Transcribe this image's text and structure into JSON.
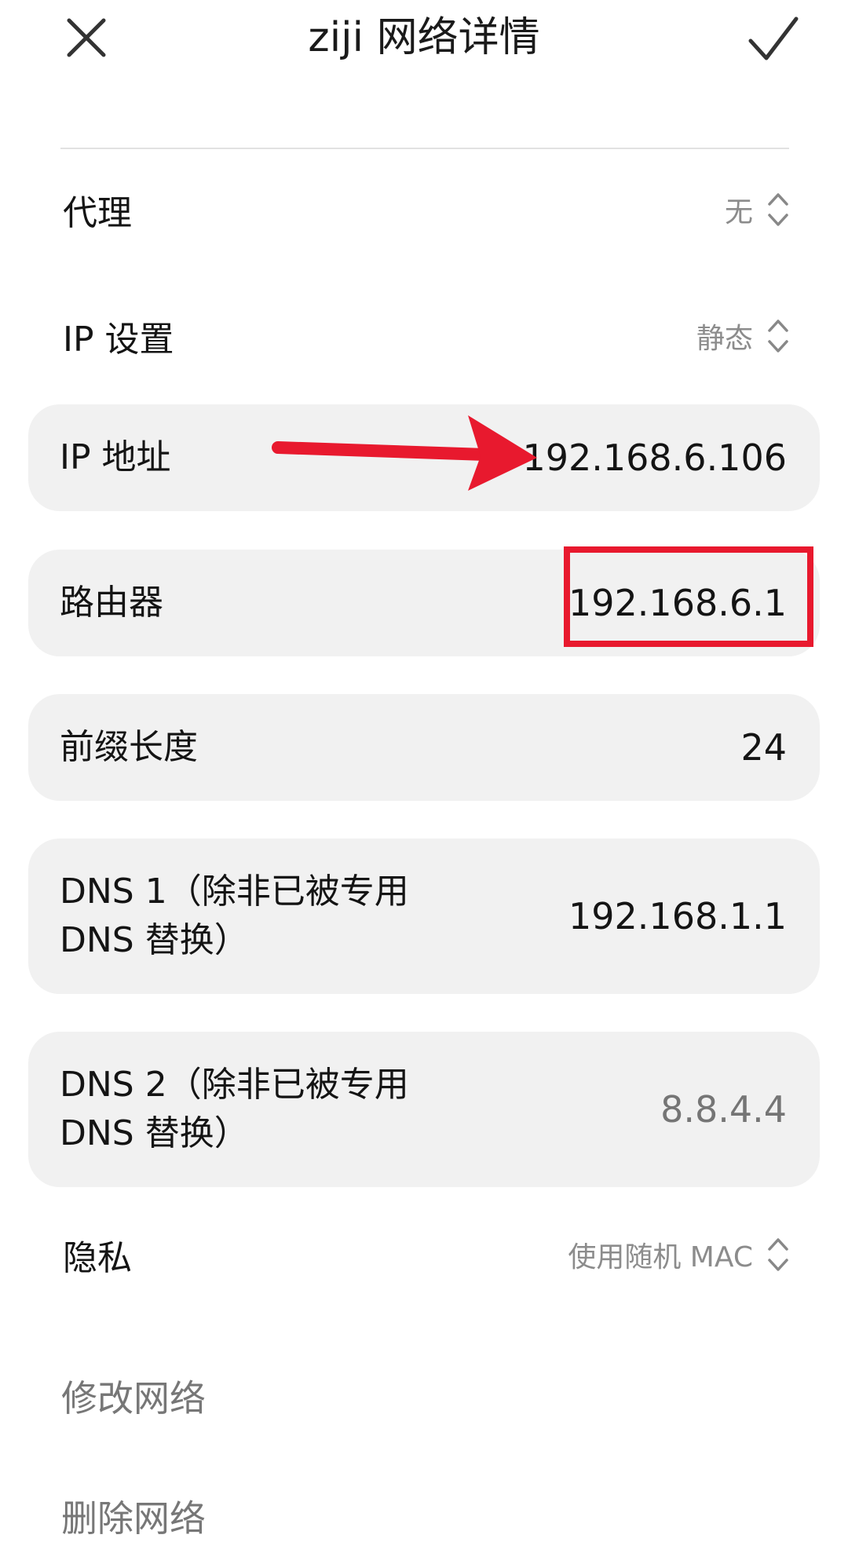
{
  "header": {
    "title": "ziji 网络详情"
  },
  "rows": {
    "proxy": {
      "label": "代理",
      "value": "无"
    },
    "ip_settings": {
      "label": "IP 设置",
      "value": "静态"
    },
    "ip_address": {
      "label": "IP 地址",
      "value": "192.168.6.106"
    },
    "router": {
      "label": "路由器",
      "value": "192.168.6.1"
    },
    "prefix_length": {
      "label": "前缀长度",
      "value": "24"
    },
    "dns1": {
      "label_line1": "DNS 1（除非已被专用",
      "label_line2": "DNS 替换）",
      "value": "192.168.1.1"
    },
    "dns2": {
      "label_line1": "DNS 2（除非已被专用",
      "label_line2": "DNS 替换）",
      "value": "8.8.4.4"
    },
    "privacy": {
      "label": "隐私",
      "value": "使用随机 MAC"
    }
  },
  "actions": {
    "modify": "修改网络",
    "delete": "删除网络"
  },
  "colors": {
    "annotation_red": "#e8192e",
    "card_background": "#f1f1f1"
  }
}
